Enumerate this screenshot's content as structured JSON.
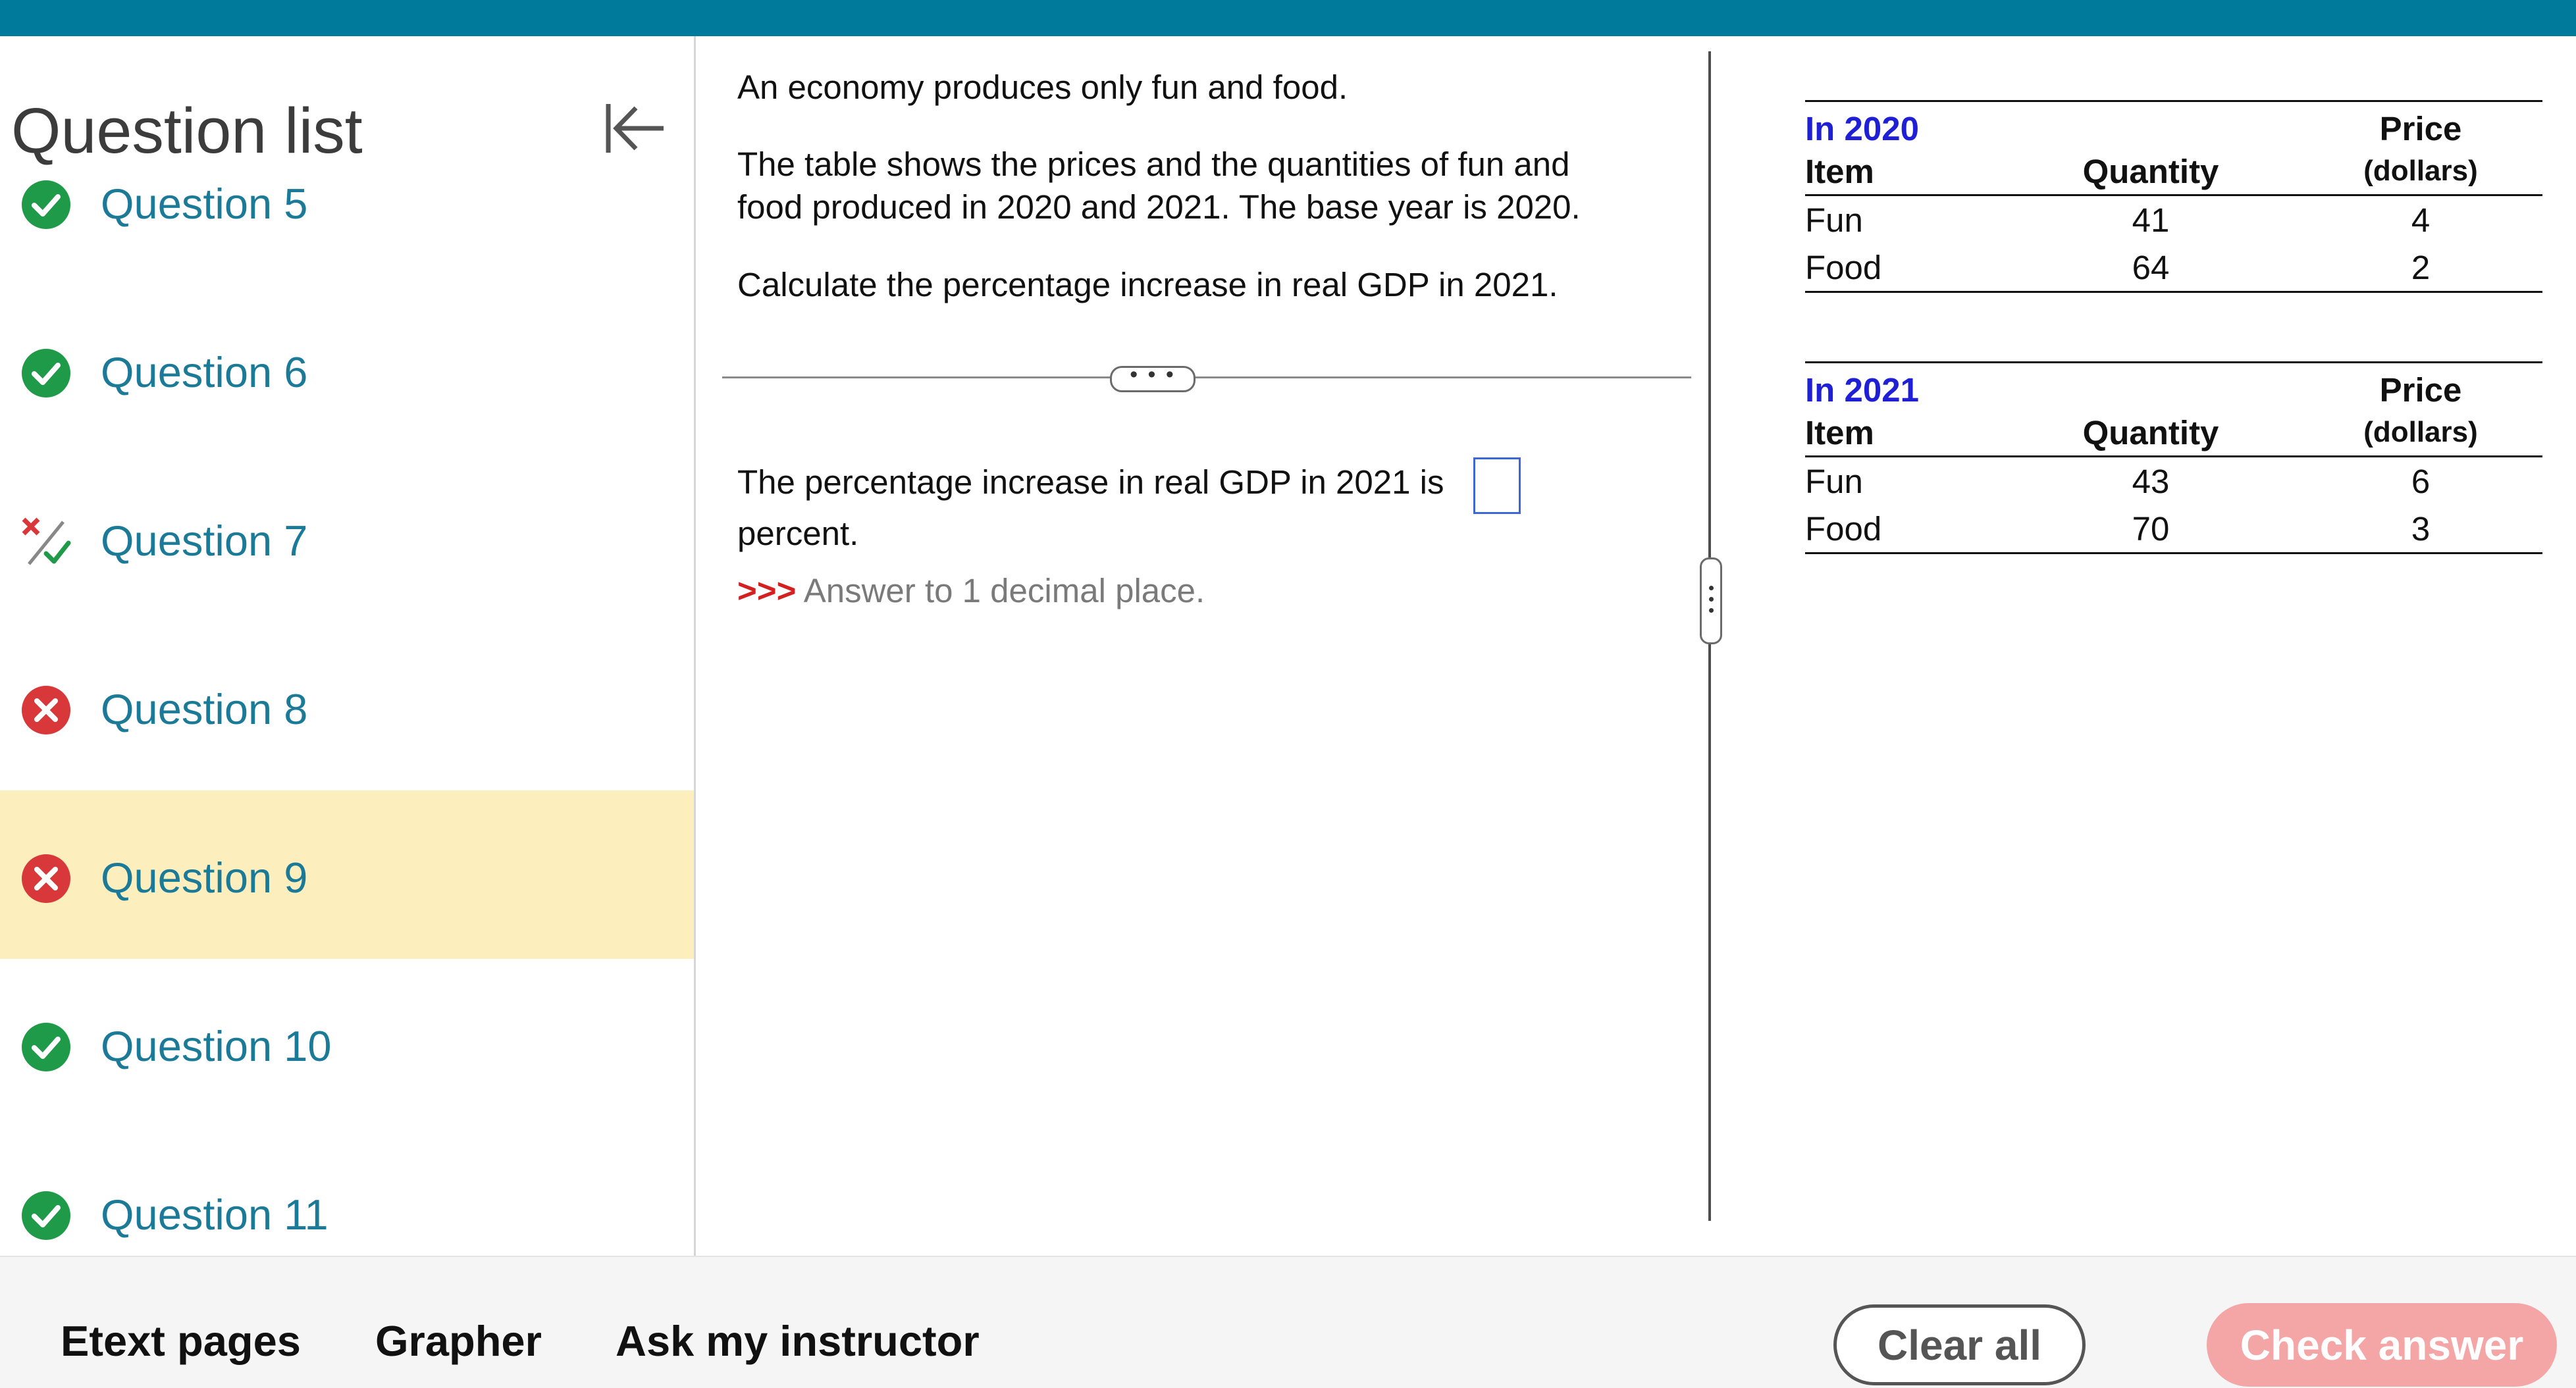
{
  "sidebar": {
    "title": "Question list",
    "items": [
      {
        "label": "Question 5",
        "status": "correct"
      },
      {
        "label": "Question 6",
        "status": "correct"
      },
      {
        "label": "Question 7",
        "status": "partial"
      },
      {
        "label": "Question 8",
        "status": "incorrect"
      },
      {
        "label": "Question 9",
        "status": "incorrect",
        "active": true
      },
      {
        "label": "Question 10",
        "status": "correct"
      },
      {
        "label": "Question 11",
        "status": "correct"
      }
    ]
  },
  "question": {
    "intro": "An economy produces only fun and food.",
    "line1": "The table shows the prices and the quantities of fun and",
    "line2": "food produced in 2020 and 2021. The base year is 2020.",
    "task": "Calculate the percentage increase in real GDP in 2021.",
    "more_handle": "• • •",
    "answer_prefix": "The percentage increase in real GDP in 2021 is",
    "answer_suffix": "percent.",
    "hint_arrows": ">>>",
    "hint_text": "Answer to 1 decimal place.",
    "answer_value": ""
  },
  "tables": [
    {
      "year_label": "In 2020",
      "headers": {
        "item": "Item",
        "quantity": "Quantity",
        "price": "Price",
        "price_unit": "(dollars)"
      },
      "rows": [
        {
          "item": "Fun",
          "quantity": "41",
          "price": "4"
        },
        {
          "item": "Food",
          "quantity": "64",
          "price": "2"
        }
      ]
    },
    {
      "year_label": "In 2021",
      "headers": {
        "item": "Item",
        "quantity": "Quantity",
        "price": "Price",
        "price_unit": "(dollars)"
      },
      "rows": [
        {
          "item": "Fun",
          "quantity": "43",
          "price": "6"
        },
        {
          "item": "Food",
          "quantity": "70",
          "price": "3"
        }
      ]
    }
  ],
  "bottom_bar": {
    "etext": "Etext pages",
    "grapher": "Grapher",
    "ask": "Ask my instructor",
    "clear": "Clear all",
    "check": "Check answer"
  },
  "colors": {
    "topbar": "#007a9b",
    "link": "#1a7a98",
    "correct": "#1f9a48",
    "incorrect": "#d9383a",
    "active_row": "#fcefbd",
    "year_label": "#1f1fd6",
    "check_button": "#f4a6a6"
  }
}
